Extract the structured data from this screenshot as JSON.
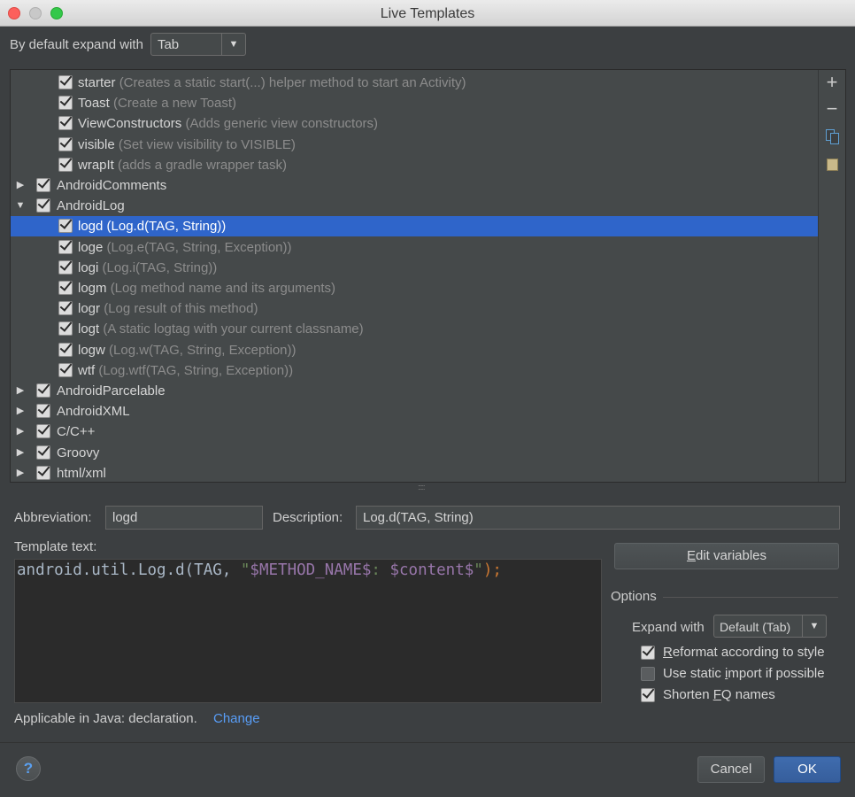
{
  "window": {
    "title": "Live Templates"
  },
  "top": {
    "label": "By default expand with",
    "expand_value": "Tab"
  },
  "tree": {
    "rows": [
      {
        "indent": 1,
        "name": "starter",
        "desc": "(Creates a static start(...) helper method to start an Activity)"
      },
      {
        "indent": 1,
        "name": "Toast",
        "desc": "(Create a new Toast)"
      },
      {
        "indent": 1,
        "name": "ViewConstructors",
        "desc": "(Adds generic view constructors)"
      },
      {
        "indent": 1,
        "name": "visible",
        "desc": "(Set view visibility to VISIBLE)"
      },
      {
        "indent": 1,
        "name": "wrapIt",
        "desc": "(adds a gradle wrapper task)"
      },
      {
        "indent": 0,
        "arrow": "▶",
        "name": "AndroidComments",
        "desc": ""
      },
      {
        "indent": 0,
        "arrow": "▼",
        "name": "AndroidLog",
        "desc": ""
      },
      {
        "indent": 1,
        "name": "logd",
        "desc": "(Log.d(TAG, String))",
        "selected": true
      },
      {
        "indent": 1,
        "name": "loge",
        "desc": "(Log.e(TAG, String, Exception))"
      },
      {
        "indent": 1,
        "name": "logi",
        "desc": "(Log.i(TAG, String))"
      },
      {
        "indent": 1,
        "name": "logm",
        "desc": "(Log method name and its arguments)"
      },
      {
        "indent": 1,
        "name": "logr",
        "desc": "(Log result of this method)"
      },
      {
        "indent": 1,
        "name": "logt",
        "desc": "(A static logtag with your current classname)"
      },
      {
        "indent": 1,
        "name": "logw",
        "desc": "(Log.w(TAG, String, Exception))"
      },
      {
        "indent": 1,
        "name": "wtf",
        "desc": "(Log.wtf(TAG, String, Exception))"
      },
      {
        "indent": 0,
        "arrow": "▶",
        "name": "AndroidParcelable",
        "desc": ""
      },
      {
        "indent": 0,
        "arrow": "▶",
        "name": "AndroidXML",
        "desc": ""
      },
      {
        "indent": 0,
        "arrow": "▶",
        "name": "C/C++",
        "desc": ""
      },
      {
        "indent": 0,
        "arrow": "▶",
        "name": "Groovy",
        "desc": ""
      },
      {
        "indent": 0,
        "arrow": "▶",
        "name": "html/xml",
        "desc": ""
      }
    ],
    "tools": {
      "add": "+",
      "remove": "−"
    }
  },
  "form": {
    "abbreviation_label": "Abbreviation:",
    "abbreviation_value": "logd",
    "description_label": "Description:",
    "description_value": "Log.d(TAG, String)",
    "template_text_label": "Template text:",
    "template_code": {
      "part1": "android.util.Log.d(TAG, ",
      "quote_open": "\"",
      "var1": "$METHOD_NAME$",
      "mid": ": ",
      "var2": "$content$",
      "quote_close": "\"",
      "close": ");"
    },
    "applicable_text": "Applicable in Java: declaration.",
    "change_link": "Change"
  },
  "edit_variables": {
    "prefix": "",
    "mnemonic": "E",
    "rest": "dit variables"
  },
  "options": {
    "title": "Options",
    "expand_label": "Expand with",
    "expand_value": "Default (Tab)",
    "reformat": {
      "mnemonic": "R",
      "rest": "eformat according to style",
      "checked": true
    },
    "static_import": {
      "before": "Use static ",
      "mnemonic": "i",
      "rest": "mport if possible",
      "checked": false
    },
    "shorten": {
      "before": "Shorten ",
      "mnemonic": "F",
      "rest": "Q names",
      "checked": true
    }
  },
  "footer": {
    "help": "?",
    "cancel": "Cancel",
    "ok": "OK"
  }
}
